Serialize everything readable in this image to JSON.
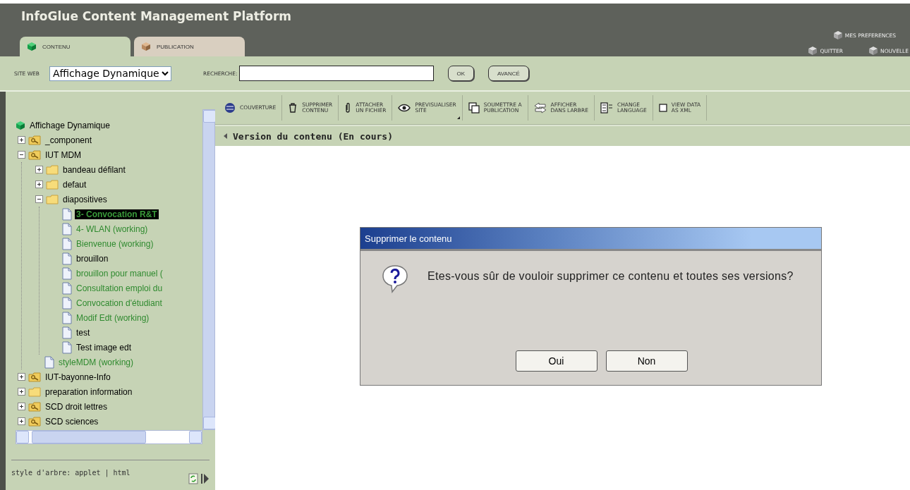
{
  "app": {
    "title": "InfoGlue Content Management Platform"
  },
  "tabs": [
    {
      "label": "CONTENU",
      "selected": true
    },
    {
      "label": "PUBLICATION",
      "selected": false
    }
  ],
  "header_links": [
    {
      "label": "MES PREFERENCES"
    },
    {
      "label": "QUITTER"
    },
    {
      "label": "NOUVELLE"
    }
  ],
  "site_selector": {
    "label": "SITE WEB",
    "value": "Affichage Dynamique"
  },
  "search": {
    "label": "RECHERCHE:",
    "buttons": [
      "OK",
      "AVANCÉ"
    ]
  },
  "tree": {
    "label": "Affichage Dynamique",
    "kind": "site",
    "selected": false,
    "working": false,
    "children": [
      {
        "label": "_component",
        "kind": "repository",
        "expanded": false,
        "selected": false,
        "working": false
      },
      {
        "label": "IUT MDM",
        "kind": "repository",
        "expanded": true,
        "selected": false,
        "working": false,
        "children": [
          {
            "label": "bandeau défilant",
            "kind": "folder",
            "expanded": false,
            "selected": false,
            "working": false
          },
          {
            "label": "defaut",
            "kind": "folder",
            "expanded": false,
            "selected": false,
            "working": false
          },
          {
            "label": "diapositives",
            "kind": "folder",
            "expanded": true,
            "selected": false,
            "working": false,
            "children": [
              {
                "label": "3- Convocation R&T",
                "kind": "document",
                "selected": true,
                "working": true
              },
              {
                "label": "4- WLAN (working)",
                "kind": "document",
                "selected": false,
                "working": true
              },
              {
                "label": "Bienvenue (working)",
                "kind": "document",
                "selected": false,
                "working": true
              },
              {
                "label": "brouillon",
                "kind": "document",
                "selected": false,
                "working": false
              },
              {
                "label": "brouillon pour manuel (",
                "kind": "document",
                "selected": false,
                "working": true
              },
              {
                "label": "Consultation emploi du",
                "kind": "document",
                "selected": false,
                "working": true
              },
              {
                "label": "Convocation d'étudiant",
                "kind": "document",
                "selected": false,
                "working": true
              },
              {
                "label": "Modif Edt (working)",
                "kind": "document",
                "selected": false,
                "working": true
              },
              {
                "label": "test",
                "kind": "document",
                "selected": false,
                "working": false
              },
              {
                "label": "Test image edt",
                "kind": "document",
                "selected": false,
                "working": false
              }
            ]
          },
          {
            "label": "styleMDM (working)",
            "kind": "document",
            "selected": false,
            "working": true
          }
        ]
      },
      {
        "label": "IUT-bayonne-Info",
        "kind": "repository",
        "expanded": false,
        "selected": false,
        "working": false
      },
      {
        "label": "preparation information",
        "kind": "folder",
        "expanded": false,
        "selected": false,
        "working": false
      },
      {
        "label": "SCD droit lettres",
        "kind": "repository",
        "expanded": false,
        "selected": false,
        "working": false
      },
      {
        "label": "SCD sciences",
        "kind": "repository",
        "expanded": false,
        "selected": false,
        "working": false
      }
    ]
  },
  "tree_footer": {
    "text": "style d'arbre: applet | html"
  },
  "toolbar": [
    {
      "lines": [
        "COUVERTURE"
      ],
      "has_menu": false
    },
    {
      "lines": [
        "SUPPRIMER",
        "CONTENU"
      ],
      "has_menu": false
    },
    {
      "lines": [
        "ATTACHER",
        "UN FICHIER"
      ],
      "has_menu": false
    },
    {
      "lines": [
        "PREVISUALISER",
        "SITE"
      ],
      "has_menu": true
    },
    {
      "lines": [
        "SOUMETTRE A",
        "PUBLICATION"
      ],
      "has_menu": false
    },
    {
      "lines": [
        "AFFICHER",
        "DANS LARBRE"
      ],
      "has_menu": false
    },
    {
      "lines": [
        "CHANGE",
        "LANGUAGE"
      ],
      "has_menu": false
    },
    {
      "lines": [
        "VIEW DATA",
        "AS XML"
      ],
      "has_menu": false
    }
  ],
  "content": {
    "heading": "Version du contenu (En cours)"
  },
  "dialog": {
    "title": "Supprimer le contenu",
    "message": "Etes-vous sûr de vouloir supprimer ce contenu et toutes ses versions?",
    "buttons": [
      "Oui",
      "Non"
    ]
  }
}
